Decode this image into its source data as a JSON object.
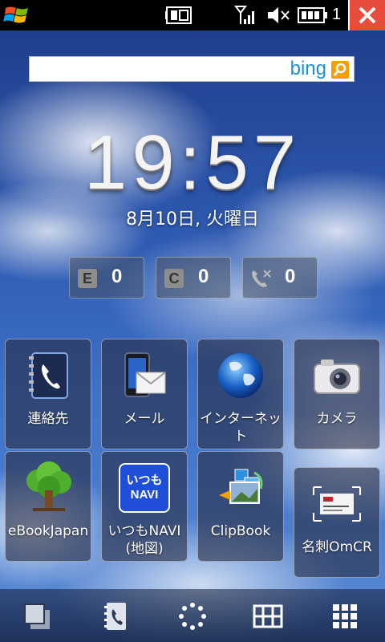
{
  "status_bar": {
    "trailing_digit": "1",
    "icons": [
      "windows-start-icon",
      "battery-indicator-icon",
      "signal-icon",
      "volume-mute-icon",
      "battery-icon",
      "close-icon"
    ]
  },
  "search": {
    "brand": "bing",
    "brand_color": "#1a8fd6",
    "button_color": "#f2a007"
  },
  "clock": {
    "time": "19:57",
    "date": "8月10日, 火曜日"
  },
  "counters": [
    {
      "icon": "email-icon",
      "glyph": "E",
      "value": "0"
    },
    {
      "icon": "calendar-icon",
      "glyph": "C",
      "value": "0"
    },
    {
      "icon": "missed-call-icon",
      "glyph": "✕",
      "value": "0"
    }
  ],
  "tiles": [
    {
      "label": "連絡先",
      "icon": "contacts-icon"
    },
    {
      "label": "メール",
      "icon": "mail-icon"
    },
    {
      "label": "インターネット",
      "icon": "internet-globe-icon"
    },
    {
      "label": "カメラ",
      "icon": "camera-icon"
    },
    {
      "label": "eBookJapan",
      "icon": "ebook-tree-icon"
    },
    {
      "label": "いつもNAVI\n(地図)",
      "icon": "navi-map-icon",
      "badge": "いつも\nNAVI"
    },
    {
      "label": "ClipBook",
      "icon": "clipbook-icon"
    },
    {
      "label": "名刺OmCR",
      "icon": "business-card-scanner-icon"
    }
  ],
  "bottom_bar": [
    "window-switch-icon",
    "contacts-book-icon",
    "loading-ring-icon",
    "grid-view-icon",
    "apps-grid-icon"
  ]
}
